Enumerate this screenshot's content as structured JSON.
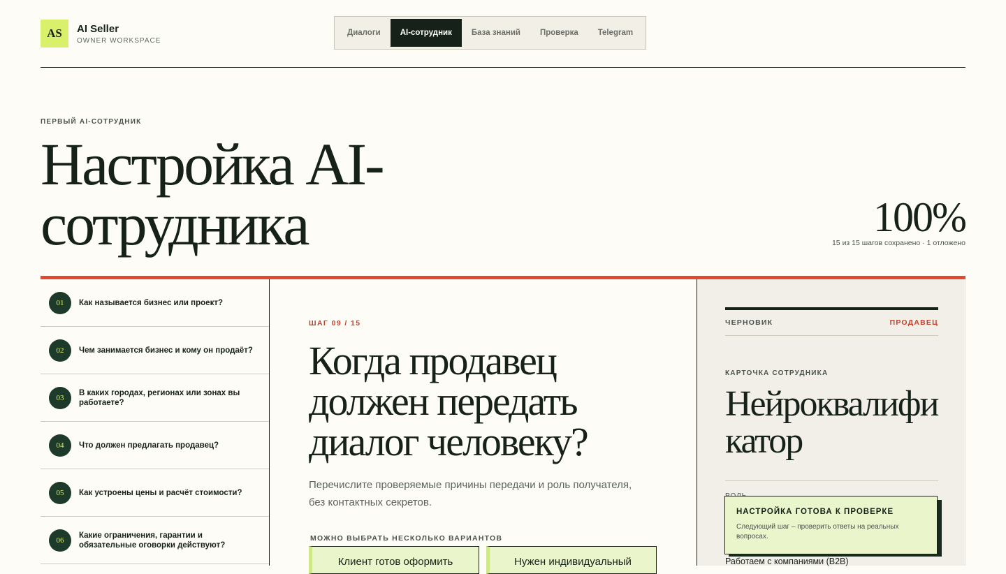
{
  "brand": {
    "logo": "AS",
    "name": "AI Seller",
    "subtitle": "OWNER WORKSPACE"
  },
  "nav": {
    "tabs": [
      "Диалоги",
      "AI-сотрудник",
      "База знаний",
      "Проверка",
      "Telegram"
    ],
    "active": "AI-сотрудник"
  },
  "hero": {
    "eyebrow": "ПЕРВЫЙ AI-СОТРУДНИК",
    "title": "Настройка AI-сотрудника",
    "progress": "100%",
    "progress_note": "15 из 15 шагов сохранено · 1 отложено"
  },
  "steps": [
    {
      "num": "01",
      "text": "Как называется бизнес или проект?"
    },
    {
      "num": "02",
      "text": "Чем занимается бизнес и кому он продаёт?"
    },
    {
      "num": "03",
      "text": "В каких городах, регионах или зонах вы работаете?"
    },
    {
      "num": "04",
      "text": "Что должен предлагать продавец?"
    },
    {
      "num": "05",
      "text": "Как устроены цены и расчёт стоимости?"
    },
    {
      "num": "06",
      "text": "Какие ограничения, гарантии и обязательные оговорки действуют?"
    }
  ],
  "question": {
    "step_label": "ШАГ 09 / 15",
    "title": "Когда продавец должен передать диалог человеку?",
    "hint": "Перечислите проверяемые причины передачи и роль получателя, без контактных секретов.",
    "multi_label": "МОЖНО ВЫБРАТЬ НЕСКОЛЬКО ВАРИАНТОВ",
    "options": [
      "Клиент готов оформить",
      "Нужен индивидуальный"
    ]
  },
  "panel": {
    "draft": "ЧЕРНОВИК",
    "role": "ПРОДАВЕЦ",
    "card_eyebrow": "КАРТОЧКА СОТРУДНИКА",
    "card_name": "Нейроквалификатор",
    "role_label": "РОЛЬ",
    "b2b": "Работаем с компаниями (B2B)"
  },
  "toast": {
    "title": "НАСТРОЙКА ГОТОВА К ПРОВЕРКЕ",
    "text": "Следующий шаг – проверить ответы на реальных вопросах."
  }
}
